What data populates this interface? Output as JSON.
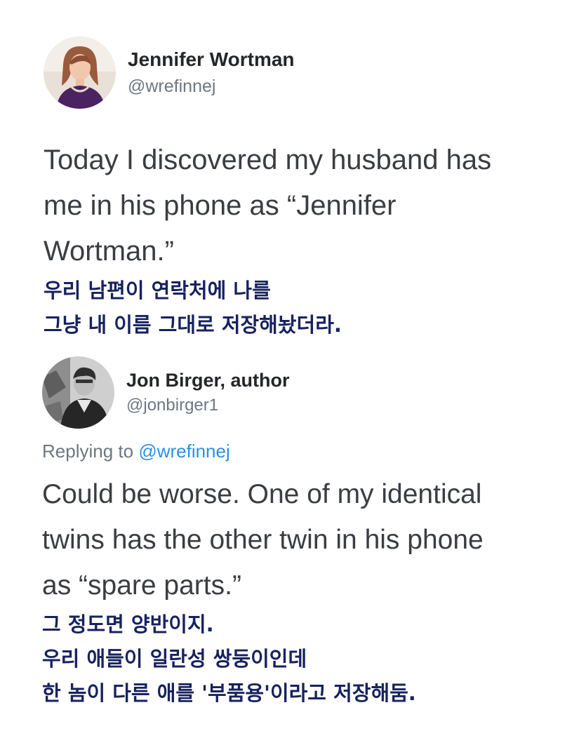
{
  "tweet": {
    "author_name": "Jennifer Wortman",
    "author_handle": "@wrefinnej",
    "lines": [
      "Today I discovered my husband has",
      "me in his phone as “Jennifer",
      "Wortman.”"
    ],
    "caption_lines": [
      "우리 남편이 연락처에 나를",
      "그냥 내 이름 그대로 저장해놨더라."
    ]
  },
  "reply": {
    "author_name": "Jon Birger, author",
    "author_handle": "@jonbirger1",
    "replying_to_label": "Replying to",
    "replying_to_handle": "@wrefinnej",
    "lines": [
      "Could be worse. One of my identical",
      "twins has the other twin in his phone",
      "as “spare parts.”"
    ],
    "caption_lines": [
      "그 정도면 양반이지.",
      "우리 애들이 일란성 쌍둥이인데",
      "한 놈이 다른 애를 '부품용'이라고 저장해둠."
    ]
  },
  "colors": {
    "caption": "#17225f",
    "mention": "#2a8fe8",
    "secondary_text": "#6d7780"
  }
}
